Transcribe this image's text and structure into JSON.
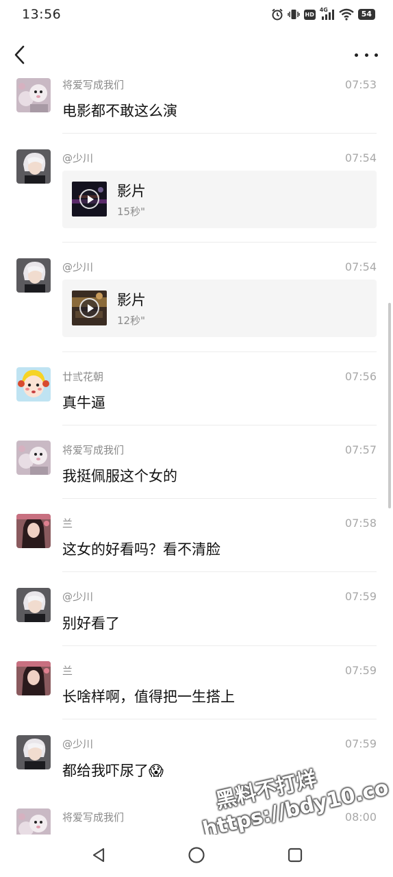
{
  "status_bar": {
    "time": "13:56",
    "icons": [
      "alarm-icon",
      "vibrate-icon",
      "hd-icon",
      "4g-signal-icon",
      "wifi-icon",
      "battery-icon"
    ],
    "hd_label": "HD",
    "network_label": "4G",
    "battery_level": "54"
  },
  "header": {
    "back_icon": "chevron-left-icon",
    "more_icon": "more-dots-icon"
  },
  "messages": [
    {
      "type": "text",
      "nickname": "将爱写成我们",
      "time": "07:53",
      "text": "电影都不敢这么演",
      "avatar": "avatar-cat-toy"
    },
    {
      "type": "video",
      "nickname": "@少川",
      "time": "07:54",
      "card_title": "影片",
      "duration": "15秒\"",
      "avatar": "avatar-white-hair"
    },
    {
      "type": "video",
      "nickname": "@少川",
      "time": "07:54",
      "card_title": "影片",
      "duration": "12秒\"",
      "avatar": "avatar-white-hair"
    },
    {
      "type": "text",
      "nickname": "廿弎花朝",
      "time": "07:56",
      "text": "真牛逼",
      "avatar": "avatar-cartoon-girl"
    },
    {
      "type": "text",
      "nickname": "将爱写成我们",
      "time": "07:57",
      "text": "我挺佩服这个女的",
      "avatar": "avatar-cat-toy"
    },
    {
      "type": "text",
      "nickname": "兰",
      "time": "07:58",
      "text": "这女的好看吗？看不清脸",
      "avatar": "avatar-woman"
    },
    {
      "type": "text",
      "nickname": "@少川",
      "time": "07:59",
      "text": "别好看了",
      "avatar": "avatar-white-hair"
    },
    {
      "type": "text",
      "nickname": "兰",
      "time": "07:59",
      "text": "长啥样啊，值得把一生搭上",
      "avatar": "avatar-woman"
    },
    {
      "type": "text",
      "nickname": "@少川",
      "time": "07:59",
      "text": "都给我吓尿了😱",
      "avatar": "avatar-white-hair"
    },
    {
      "type": "text",
      "nickname": "将爱写成我们",
      "time": "08:00",
      "text": "",
      "avatar": "avatar-cat-toy"
    }
  ],
  "watermark": {
    "line1": "黑料不打烊",
    "line2": "https://bdy10.co"
  },
  "nav_bar": {
    "icons": [
      "nav-back-triangle-icon",
      "nav-home-circle-icon",
      "nav-recents-square-icon"
    ]
  },
  "colors": {
    "nickname": "#8a8a8a",
    "time": "#a8a8a8",
    "card_bg": "#f5f5f5",
    "divider": "#ececec"
  }
}
